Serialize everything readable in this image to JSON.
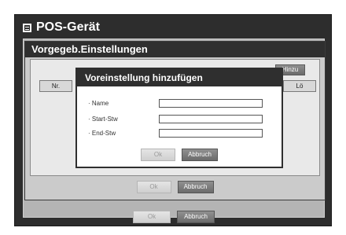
{
  "window": {
    "title": "POS-Gerät",
    "icon": "menu-icon",
    "footer": {
      "ok_label": "Ok",
      "cancel_label": "Abbruch"
    }
  },
  "panel": {
    "title": "Vorgegeb.Einstellungen",
    "add_label": "Hinzu",
    "columns": [
      "Nr.",
      "Lö"
    ],
    "footer": {
      "ok_label": "Ok",
      "cancel_label": "Abbruch"
    }
  },
  "dialog": {
    "title": "Voreinstellung hinzufügen",
    "fields": [
      {
        "label": "· Name",
        "value": ""
      },
      {
        "label": "· Start-Stw",
        "value": ""
      },
      {
        "label": "· End-Stw",
        "value": ""
      }
    ],
    "ok_label": "Ok",
    "cancel_label": "Abbruch"
  },
  "colors": {
    "title_bar": "#2f2f2f",
    "button_dark": "#6b6b6b",
    "button_light": "#cfcfcf"
  }
}
